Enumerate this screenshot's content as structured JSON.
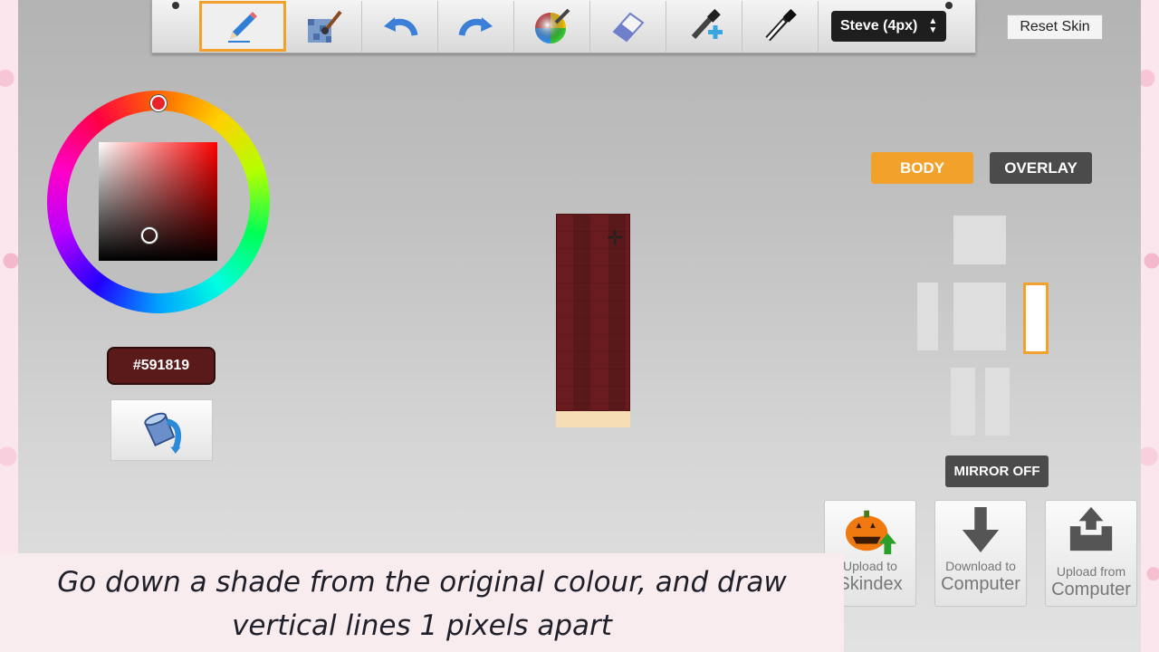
{
  "toolbar": {
    "tools": [
      {
        "name": "pencil-icon",
        "active": true
      },
      {
        "name": "brush-noise-icon",
        "active": false
      },
      {
        "name": "undo-icon",
        "active": false
      },
      {
        "name": "redo-icon",
        "active": false
      },
      {
        "name": "color-picker-icon",
        "active": false
      },
      {
        "name": "eraser-icon",
        "active": false
      },
      {
        "name": "darken-dropper-icon",
        "active": false
      },
      {
        "name": "lighten-dropper-icon",
        "active": false
      }
    ],
    "model_select": "Steve (4px)",
    "reset_label": "Reset Skin"
  },
  "color": {
    "hex": "#591819",
    "swatch": "#591819"
  },
  "tabs": {
    "body": "BODY",
    "overlay": "OVERLAY"
  },
  "mirror_label": "MIRROR OFF",
  "actions": [
    {
      "line1": "Upload to",
      "line2": "Skindex"
    },
    {
      "line1": "Download to",
      "line2": "Computer"
    },
    {
      "line1": "Upload from",
      "line2": "Computer"
    }
  ],
  "caption": {
    "line1": "Go down a shade from the original colour, and draw",
    "line2": "vertical lines 1 pixels apart"
  },
  "colors": {
    "accent": "#f2a22b",
    "dark_button": "#4b4b4b",
    "skin_red": "#6a1b1f",
    "skin_stripe": "#591819",
    "skin_feet": "#f6ddb5"
  }
}
